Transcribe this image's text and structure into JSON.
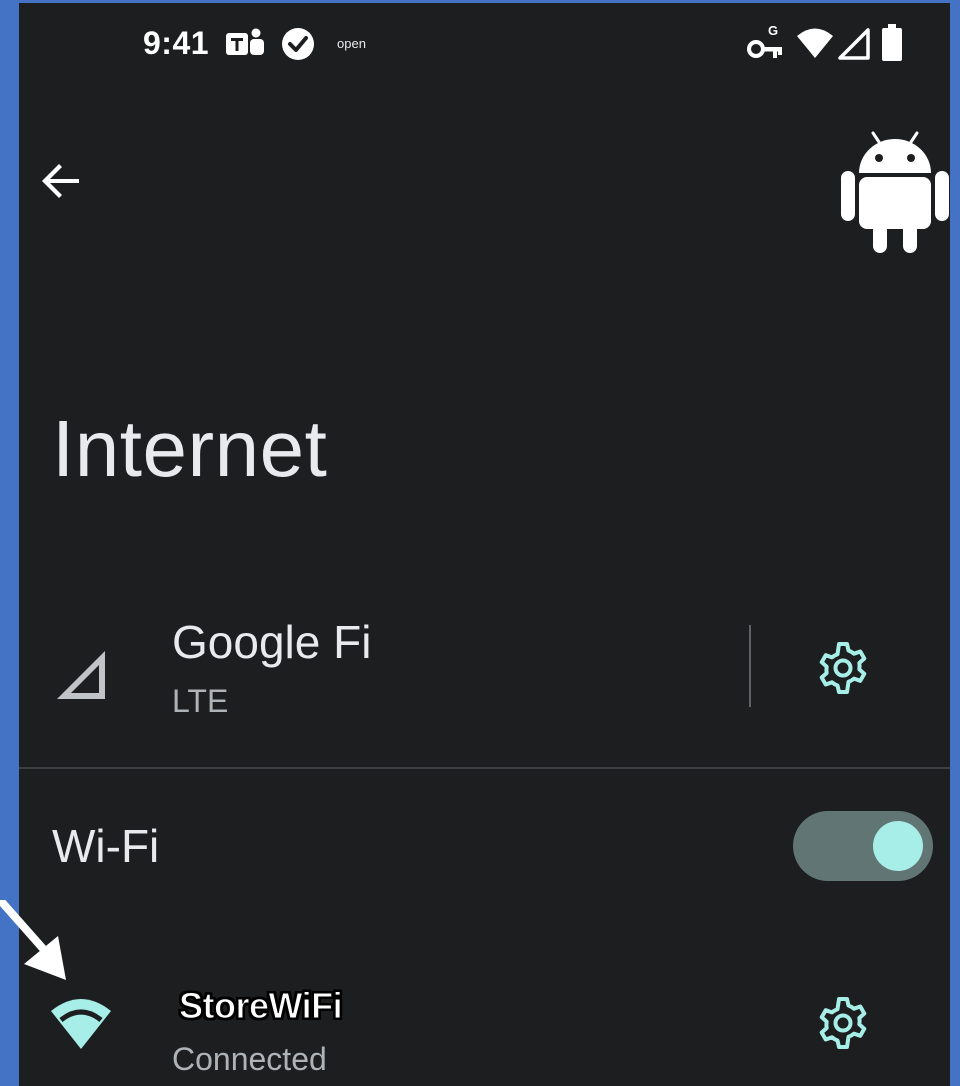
{
  "status_bar": {
    "time": "9:41",
    "label": "open",
    "icons": [
      "teams-icon",
      "check-circle-icon",
      "vpn-key-icon",
      "wifi-icon",
      "cell-signal-icon",
      "battery-icon"
    ]
  },
  "header": {
    "title": "Internet"
  },
  "mobile_network": {
    "name": "Google Fi",
    "type": "LTE"
  },
  "wifi": {
    "label": "Wi-Fi",
    "enabled": true
  },
  "networks": [
    {
      "name": "StoreWiFi",
      "status": "Connected"
    }
  ],
  "colors": {
    "accent": "#a8eee8",
    "background": "#1c1e1f",
    "frame": "#4472c4",
    "switch_track": "#607574"
  }
}
